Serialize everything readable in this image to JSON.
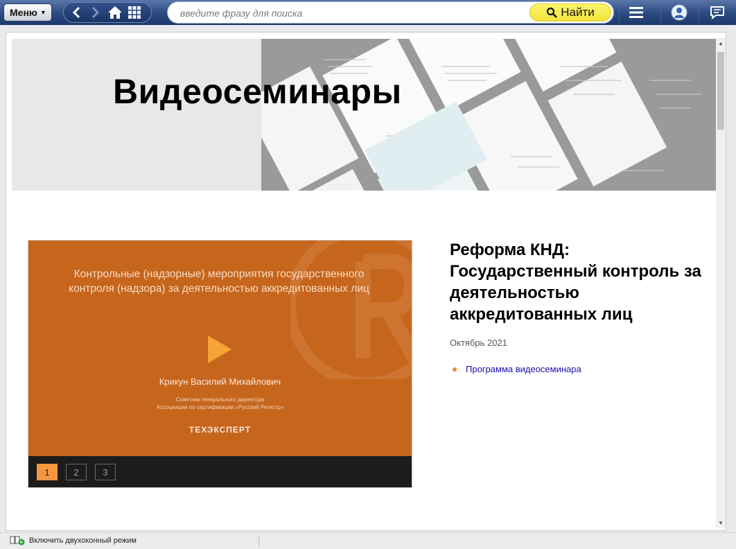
{
  "toolbar": {
    "menu_label": "Меню",
    "search_placeholder": "введите фразу для поиска",
    "find_label": "Найти"
  },
  "banner": {
    "title": "Видеосеминары"
  },
  "video": {
    "slide_title": "Контрольные (надзорные) мероприятия государственного контроля (надзора) за деятельностью аккредитованных лиц",
    "speaker": "Крикун Василий Михайлович",
    "role_line1": "Советник генерального директора",
    "role_line2": "Ассоциации по сертификации «Русский Регистр»",
    "brand": "ТЕХЭКСПЕРТ",
    "pages": [
      "1",
      "2",
      "3"
    ],
    "active_page": "1",
    "accent_color": "#c6651c"
  },
  "seminar": {
    "title": "Реформа КНД: Государственный контроль за деятельностью аккредитованных лиц",
    "date": "Октябрь 2021",
    "program_link": "Программа видеосеминара"
  },
  "statusbar": {
    "dual_window": "Включить двухоконный режим"
  }
}
